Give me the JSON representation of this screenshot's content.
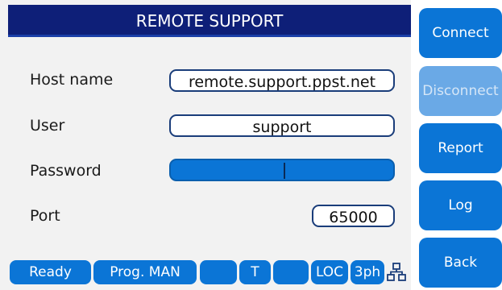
{
  "title": "REMOTE SUPPORT",
  "form": {
    "host_label": "Host name",
    "host_value": "remote.support.ppst.net",
    "user_label": "User",
    "user_value": "support",
    "password_label": "Password",
    "password_value": "",
    "port_label": "Port",
    "port_value": "65000"
  },
  "sidebar": {
    "connect": "Connect",
    "disconnect": "Disconnect",
    "report": "Report",
    "log": "Log",
    "back": "Back"
  },
  "status": {
    "ready": "Ready",
    "prog": "Prog. MAN",
    "blank1": "",
    "t": "T",
    "blank2": "",
    "loc": "LOC",
    "phase": "3ph",
    "network_icon": "network-icon"
  },
  "colors": {
    "title_bar": "#0e1f78",
    "accent_blue": "#0b75d6",
    "disabled_blue": "#6aa9e6",
    "panel_bg": "#f2f2f2"
  }
}
